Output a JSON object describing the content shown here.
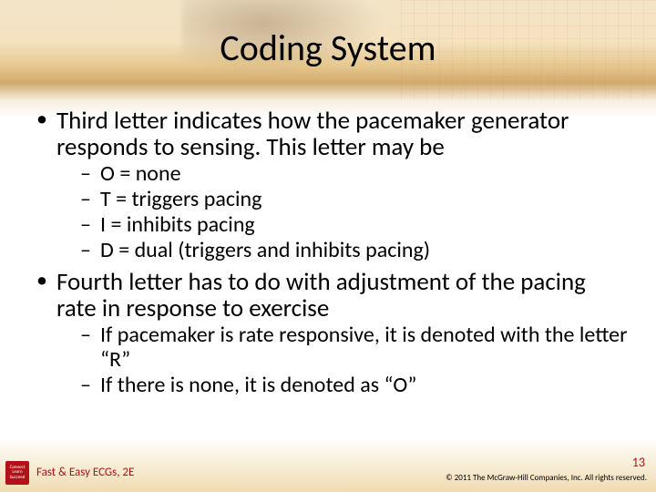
{
  "title": "Coding System",
  "bullets": [
    {
      "text": "Third letter indicates how the pacemaker generator responds to sensing. This letter may be",
      "sub": [
        "O = none",
        "T = triggers pacing",
        "I = inhibits pacing",
        "D = dual (triggers and inhibits pacing)"
      ]
    },
    {
      "text": "Fourth letter has to do with adjustment of the pacing rate in response to exercise",
      "sub": [
        "If pacemaker is rate responsive, it is denoted with the letter “R”",
        "If there is none, it is denoted as “O”"
      ]
    }
  ],
  "footer": {
    "book": "Fast & Easy ECGs, 2E",
    "page": "13",
    "copyright": "© 2011 The McGraw-Hill Companies, Inc. All rights reserved.",
    "logo_lines": [
      "Connect",
      "Learn",
      "Succeed"
    ]
  }
}
